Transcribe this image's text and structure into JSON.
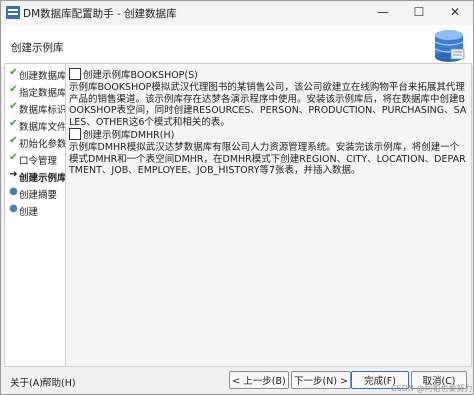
{
  "window": {
    "title": "DM数据库配置助手 - 创建数据库",
    "minimize_glyph": "—",
    "maximize_glyph": "☐",
    "close_glyph": "✕"
  },
  "header": {
    "title": "创建示例库"
  },
  "sidebar": {
    "items": [
      {
        "label": "创建数据库模板",
        "state": "done",
        "glyph": "✔"
      },
      {
        "label": "指定数据库目录",
        "state": "done",
        "glyph": "✔"
      },
      {
        "label": "数据库标识",
        "state": "done",
        "glyph": "✔"
      },
      {
        "label": "数据库文件",
        "state": "done",
        "glyph": "✔"
      },
      {
        "label": "初始化参数",
        "state": "done",
        "glyph": "✔"
      },
      {
        "label": "口令管理",
        "state": "done",
        "glyph": "✔"
      },
      {
        "label": "创建示例库",
        "state": "current",
        "glyph": "➜"
      },
      {
        "label": "创建摘要",
        "state": "pending",
        "glyph": "●"
      },
      {
        "label": "创建",
        "state": "pending",
        "glyph": "●"
      }
    ]
  },
  "options": [
    {
      "label": "创建示例库BOOKSHOP(S)",
      "checked": false,
      "description": "示例库BOOKSHOP模拟武汉代理图书的某销售公司，该公司欲建立在线购物平台来拓展其代理产品的销售渠道。该示例库存在达梦各演示程序中使用。安装该示例库后，将在数据库中创建BOOKSHOP表空间，同时创建RESOURCES、PERSON、PRODUCTION、PURCHASING、SALES、OTHER这6个模式和相关的表。"
    },
    {
      "label": "创建示例库DMHR(H)",
      "checked": false,
      "description": "示例库DMHR模拟武汉达梦数据库有限公司人力资源管理系统。安装完该示例库，将创建一个模式DMHR和一个表空间DMHR，在DMHR模式下创建REGION、CITY、LOCATION、DEPARTMENT、JOB、EMPLOYEE、JOB_HISTORY等7张表，并插入数据。"
    }
  ],
  "footer": {
    "about": "关于(A)",
    "help": "帮助(H)",
    "prev": "< 上一步(B)",
    "next": "下一步(N) >",
    "finish": "完成(F)",
    "cancel": "取消(C)"
  },
  "watermark": "CSDN @阿帕也爱努力",
  "colors": {
    "check": "#2e9e3e",
    "primary_border": "#2a6fd0",
    "db_icon": "#3a7bd5"
  }
}
